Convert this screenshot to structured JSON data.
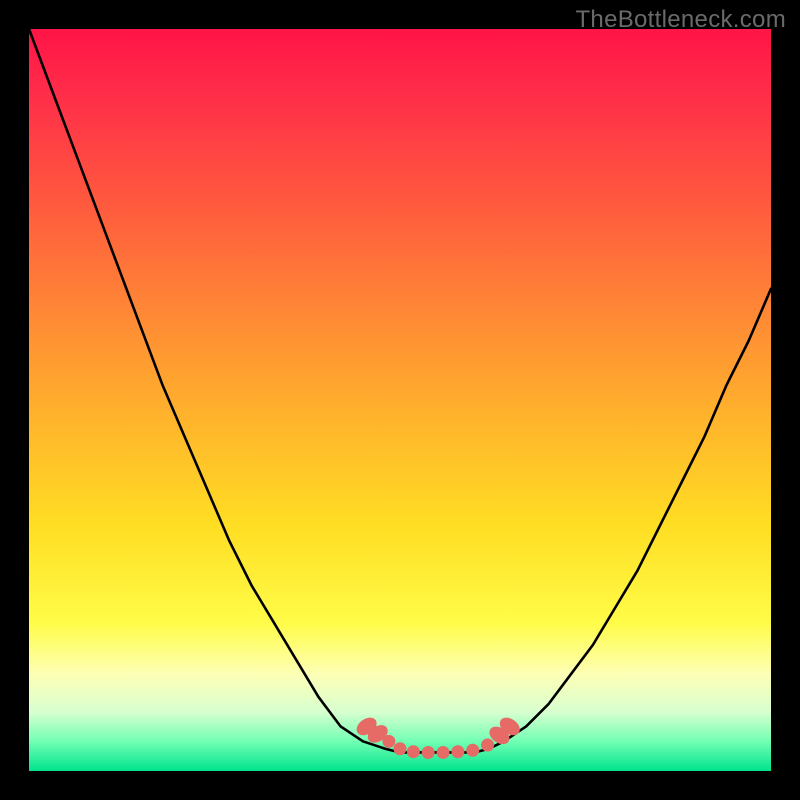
{
  "watermark": "TheBottleneck.com",
  "colors": {
    "frame": "#000000",
    "curve": "#000000",
    "marker": "#e66a65",
    "gradient_top": "#ff1447",
    "gradient_mid": "#ffde23",
    "gradient_bottom": "#00e38c"
  },
  "chart_data": {
    "type": "line",
    "title": "",
    "xlabel": "",
    "ylabel": "",
    "x": [
      0.0,
      0.03,
      0.06,
      0.09,
      0.12,
      0.15,
      0.18,
      0.21,
      0.24,
      0.27,
      0.3,
      0.33,
      0.36,
      0.39,
      0.42,
      0.45,
      0.48,
      0.5,
      0.52,
      0.54,
      0.56,
      0.58,
      0.6,
      0.62,
      0.64,
      0.67,
      0.7,
      0.73,
      0.76,
      0.79,
      0.82,
      0.85,
      0.88,
      0.91,
      0.94,
      0.97,
      1.0
    ],
    "y": [
      1.0,
      0.92,
      0.84,
      0.76,
      0.68,
      0.6,
      0.52,
      0.45,
      0.38,
      0.31,
      0.25,
      0.2,
      0.15,
      0.1,
      0.06,
      0.04,
      0.03,
      0.025,
      0.025,
      0.025,
      0.025,
      0.025,
      0.025,
      0.03,
      0.04,
      0.06,
      0.09,
      0.13,
      0.17,
      0.22,
      0.27,
      0.33,
      0.39,
      0.45,
      0.52,
      0.58,
      0.65
    ],
    "xlim": [
      0,
      1
    ],
    "ylim": [
      0,
      1
    ],
    "markers": {
      "note": "salmon dots/pills near the valley of the curve",
      "points_x": [
        0.455,
        0.47,
        0.485,
        0.5,
        0.518,
        0.538,
        0.558,
        0.578,
        0.598,
        0.618,
        0.634,
        0.648
      ],
      "points_y": [
        0.06,
        0.05,
        0.04,
        0.03,
        0.026,
        0.025,
        0.025,
        0.026,
        0.028,
        0.035,
        0.048,
        0.06
      ]
    }
  }
}
